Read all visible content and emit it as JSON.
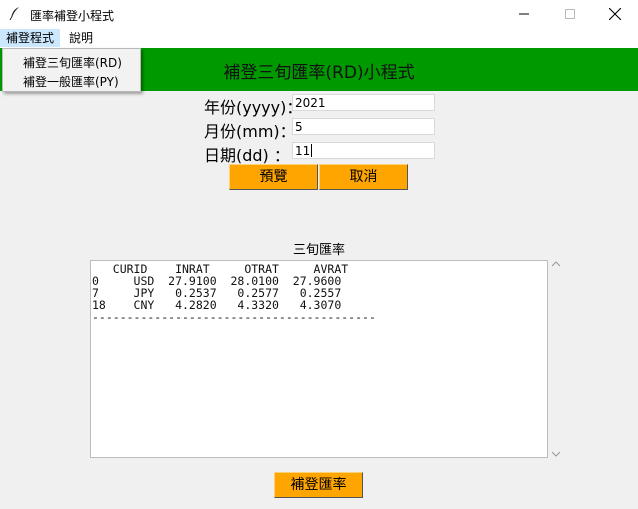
{
  "window": {
    "title": "匯率補登小程式"
  },
  "menubar": {
    "items": [
      "補登程式",
      "說明"
    ]
  },
  "dropdown": {
    "items": [
      "補登三旬匯率(RD)",
      "補登一般匯率(PY)"
    ]
  },
  "banner": {
    "title": "補登三旬匯率(RD)小程式"
  },
  "form": {
    "year_label": "年份(yyyy)：",
    "year_value": "2021",
    "month_label": "月份(mm)：",
    "month_value": "5",
    "day_label": "日期(dd)  ：",
    "day_value": "11"
  },
  "buttons": {
    "preview": "預覽",
    "cancel": "取消",
    "submit": "補登匯率"
  },
  "section": {
    "title": "三旬匯率"
  },
  "table": {
    "header": "   CURID    INRAT     OTRAT     AVRAT",
    "rows": [
      "0     USD  27.9100  28.0100  27.9600",
      "7     JPY   0.2537   0.2577   0.2557",
      "18    CNY   4.2820   4.3320   4.3070"
    ],
    "separator": "-----------------------------------------"
  },
  "colors": {
    "banner": "#009900",
    "button": "#ffa500",
    "menu_highlight": "#cce8ff"
  },
  "icons": [
    "feather-icon",
    "minimize-icon",
    "maximize-icon",
    "close-icon",
    "scroll-up-icon",
    "scroll-down-icon"
  ]
}
